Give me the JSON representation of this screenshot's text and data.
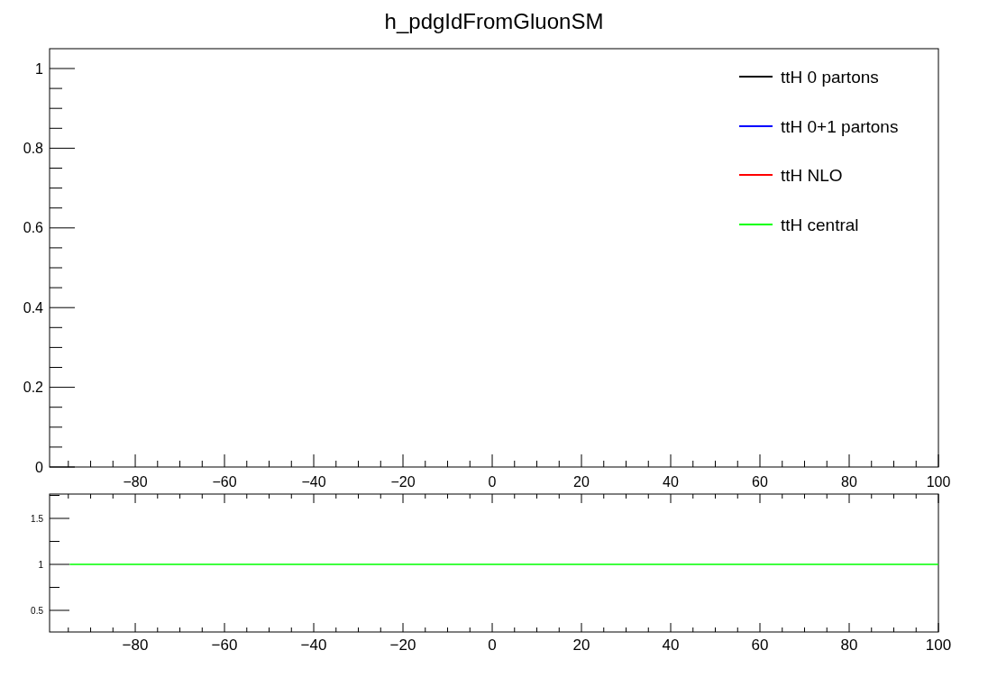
{
  "title": "h_pdgIdFromGluonSM",
  "main_panel": {
    "y_axis": {
      "tick_labels": [
        "1",
        "0.8",
        "0.6",
        "0.4",
        "0.2",
        "0"
      ]
    },
    "x_axis": {
      "tick_labels": [
        "−80",
        "−60",
        "−40",
        "−20",
        "0",
        "20",
        "40",
        "60",
        "80",
        "100"
      ]
    },
    "legend": [
      {
        "label": "ttH 0 partons",
        "color": "#000000"
      },
      {
        "label": "ttH 0+1 partons",
        "color": "#0000ff"
      },
      {
        "label": "ttH NLO",
        "color": "#ff0000"
      },
      {
        "label": "ttH central",
        "color": "#00ff00"
      }
    ]
  },
  "ratio_panel": {
    "y_axis": {
      "tick_labels": [
        "1.5",
        "1",
        "0.5"
      ]
    },
    "x_axis": {
      "tick_labels": [
        "−80",
        "−60",
        "−40",
        "−20",
        "0",
        "20",
        "40",
        "60",
        "80",
        "100"
      ]
    }
  }
}
